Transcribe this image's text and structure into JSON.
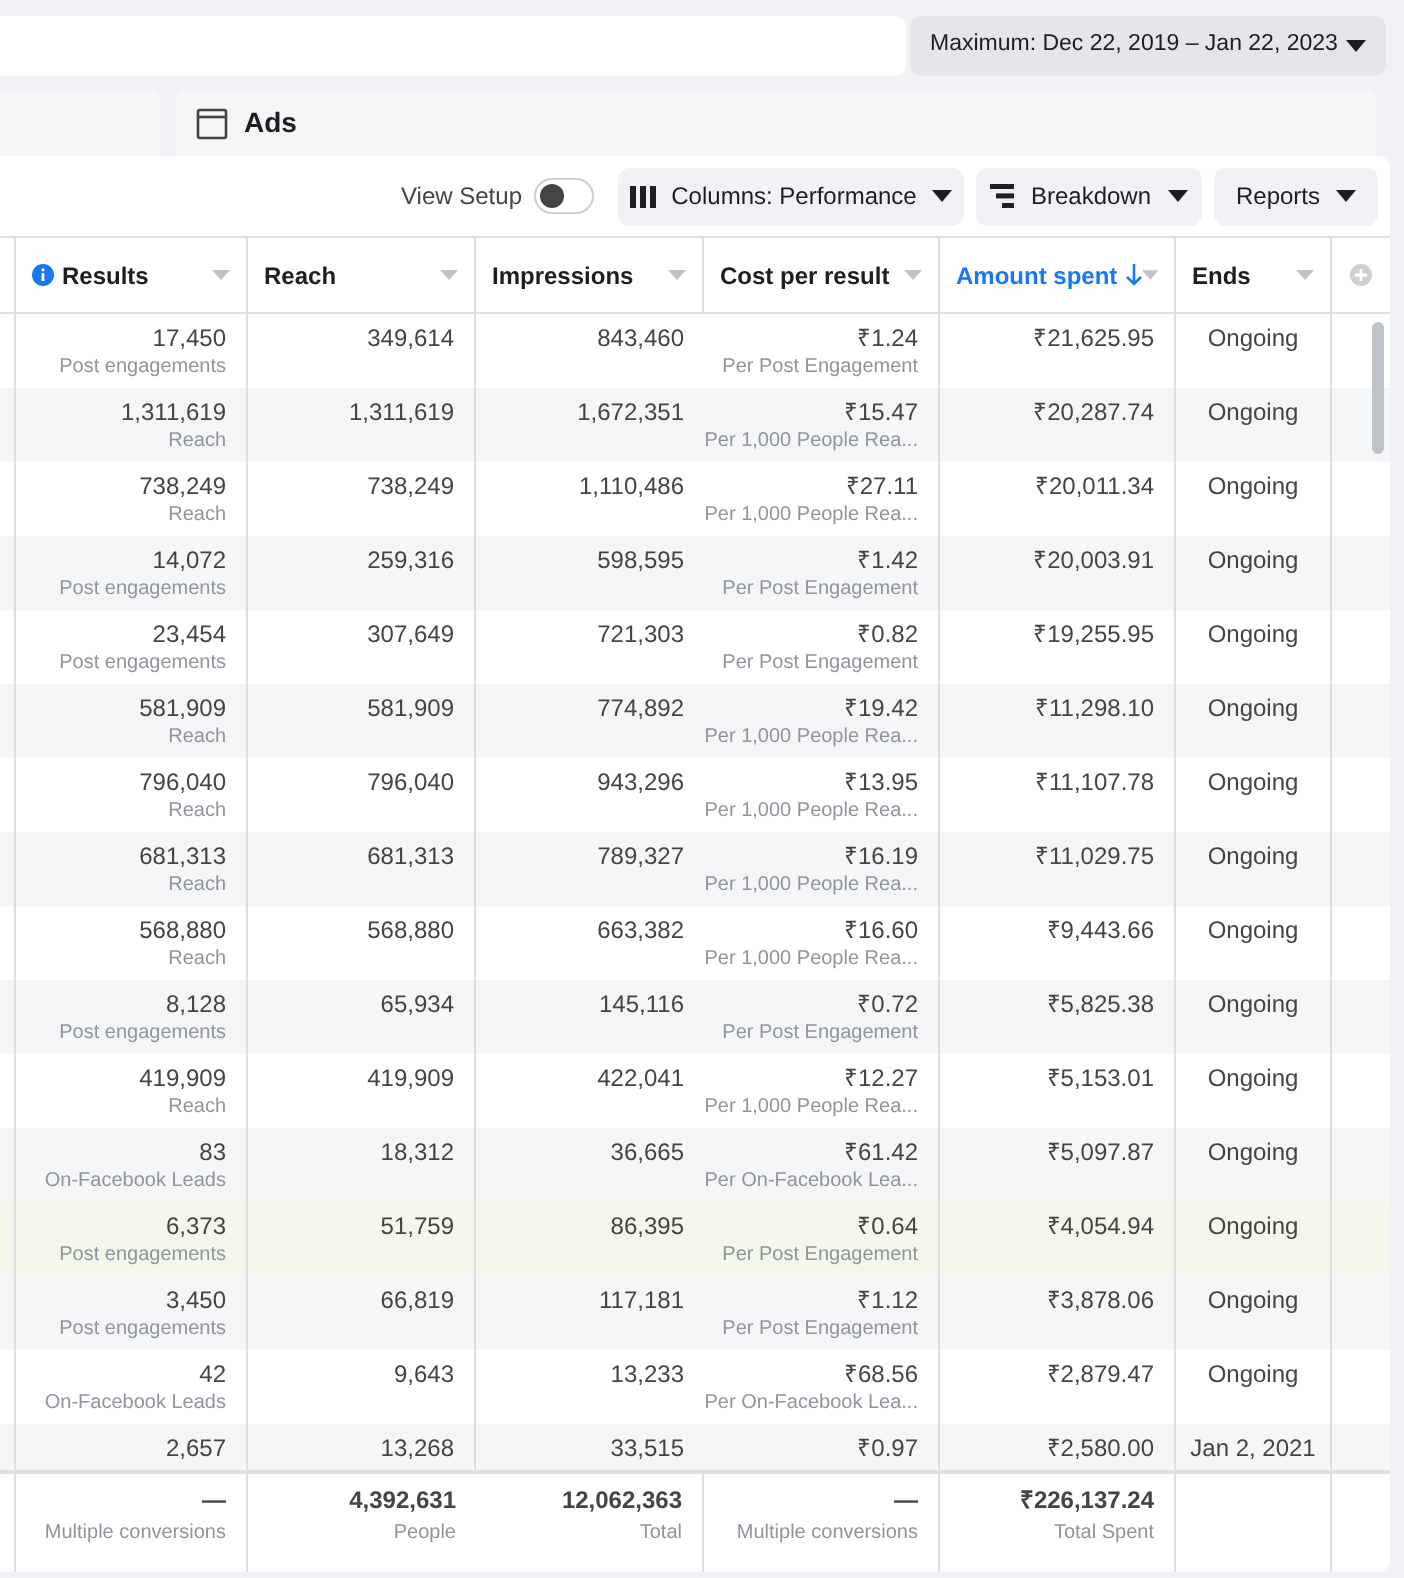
{
  "date_range": {
    "label": "Maximum: Dec 22, 2019 – Jan 22, 2023"
  },
  "level_tab": {
    "label": "Ads"
  },
  "toolbar": {
    "view_setup": {
      "label": "View Setup",
      "on": false
    },
    "buttons": [
      {
        "kind": "columns",
        "label": "Columns: Performance"
      },
      {
        "kind": "breakdown",
        "label": "Breakdown"
      },
      {
        "kind": "reports",
        "label": "Reports"
      }
    ]
  },
  "table": {
    "columns": [
      {
        "label": "Results",
        "info": true,
        "sorted": false
      },
      {
        "label": "Reach",
        "info": false,
        "sorted": false
      },
      {
        "label": "Impressions",
        "info": false,
        "sorted": false
      },
      {
        "label": "Cost per result",
        "info": false,
        "sorted": false
      },
      {
        "label": "Amount spent",
        "info": false,
        "sorted": true
      },
      {
        "label": "Ends",
        "info": false,
        "sorted": false
      }
    ],
    "rows": [
      {
        "results": "17,450",
        "result_type": "Post engagements",
        "reach": "349,614",
        "impressions": "843,460",
        "cost": "₹1.24",
        "cost_type": "Per Post Engagement",
        "amount": "₹21,625.95",
        "ends": "Ongoing",
        "highlighted": false
      },
      {
        "results": "1,311,619",
        "result_type": "Reach",
        "reach": "1,311,619",
        "impressions": "1,672,351",
        "cost": "₹15.47",
        "cost_type": "Per 1,000 People Rea...",
        "amount": "₹20,287.74",
        "ends": "Ongoing",
        "highlighted": false
      },
      {
        "results": "738,249",
        "result_type": "Reach",
        "reach": "738,249",
        "impressions": "1,110,486",
        "cost": "₹27.11",
        "cost_type": "Per 1,000 People Rea...",
        "amount": "₹20,011.34",
        "ends": "Ongoing",
        "highlighted": false
      },
      {
        "results": "14,072",
        "result_type": "Post engagements",
        "reach": "259,316",
        "impressions": "598,595",
        "cost": "₹1.42",
        "cost_type": "Per Post Engagement",
        "amount": "₹20,003.91",
        "ends": "Ongoing",
        "highlighted": false
      },
      {
        "results": "23,454",
        "result_type": "Post engagements",
        "reach": "307,649",
        "impressions": "721,303",
        "cost": "₹0.82",
        "cost_type": "Per Post Engagement",
        "amount": "₹19,255.95",
        "ends": "Ongoing",
        "highlighted": false
      },
      {
        "results": "581,909",
        "result_type": "Reach",
        "reach": "581,909",
        "impressions": "774,892",
        "cost": "₹19.42",
        "cost_type": "Per 1,000 People Rea...",
        "amount": "₹11,298.10",
        "ends": "Ongoing",
        "highlighted": false
      },
      {
        "results": "796,040",
        "result_type": "Reach",
        "reach": "796,040",
        "impressions": "943,296",
        "cost": "₹13.95",
        "cost_type": "Per 1,000 People Rea...",
        "amount": "₹11,107.78",
        "ends": "Ongoing",
        "highlighted": false
      },
      {
        "results": "681,313",
        "result_type": "Reach",
        "reach": "681,313",
        "impressions": "789,327",
        "cost": "₹16.19",
        "cost_type": "Per 1,000 People Rea...",
        "amount": "₹11,029.75",
        "ends": "Ongoing",
        "highlighted": false
      },
      {
        "results": "568,880",
        "result_type": "Reach",
        "reach": "568,880",
        "impressions": "663,382",
        "cost": "₹16.60",
        "cost_type": "Per 1,000 People Rea...",
        "amount": "₹9,443.66",
        "ends": "Ongoing",
        "highlighted": false
      },
      {
        "results": "8,128",
        "result_type": "Post engagements",
        "reach": "65,934",
        "impressions": "145,116",
        "cost": "₹0.72",
        "cost_type": "Per Post Engagement",
        "amount": "₹5,825.38",
        "ends": "Ongoing",
        "highlighted": false
      },
      {
        "results": "419,909",
        "result_type": "Reach",
        "reach": "419,909",
        "impressions": "422,041",
        "cost": "₹12.27",
        "cost_type": "Per 1,000 People Rea...",
        "amount": "₹5,153.01",
        "ends": "Ongoing",
        "highlighted": false
      },
      {
        "results": "83",
        "result_type": "On-Facebook Leads",
        "reach": "18,312",
        "impressions": "36,665",
        "cost": "₹61.42",
        "cost_type": "Per On-Facebook Lea...",
        "amount": "₹5,097.87",
        "ends": "Ongoing",
        "highlighted": false
      },
      {
        "results": "6,373",
        "result_type": "Post engagements",
        "reach": "51,759",
        "impressions": "86,395",
        "cost": "₹0.64",
        "cost_type": "Per Post Engagement",
        "amount": "₹4,054.94",
        "ends": "Ongoing",
        "highlighted": true
      },
      {
        "results": "3,450",
        "result_type": "Post engagements",
        "reach": "66,819",
        "impressions": "117,181",
        "cost": "₹1.12",
        "cost_type": "Per Post Engagement",
        "amount": "₹3,878.06",
        "ends": "Ongoing",
        "highlighted": false
      },
      {
        "results": "42",
        "result_type": "On-Facebook Leads",
        "reach": "9,643",
        "impressions": "13,233",
        "cost": "₹68.56",
        "cost_type": "Per On-Facebook Lea...",
        "amount": "₹2,879.47",
        "ends": "Ongoing",
        "highlighted": false
      },
      {
        "results": "2,657",
        "reach": "13,268",
        "impressions": "33,515",
        "cost": "₹0.97",
        "amount": "₹2,580.00",
        "ends": "Jan 2, 2021",
        "highlighted": false
      }
    ],
    "totals": [
      {
        "value": "—",
        "label": "Multiple conversions"
      },
      {
        "value": "4,392,631",
        "label": "People"
      },
      {
        "value": "12,062,363",
        "label": "Total"
      },
      {
        "value": "—",
        "label": "Multiple conversions"
      },
      {
        "value": "₹226,137.24",
        "label": "Total Spent"
      }
    ]
  }
}
